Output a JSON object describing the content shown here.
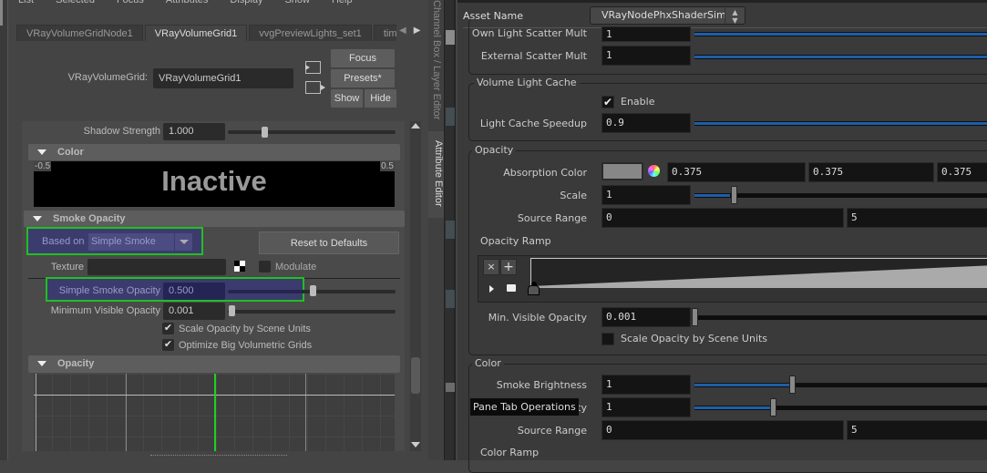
{
  "maya": {
    "menu": [
      "List",
      "Selected",
      "Focus",
      "Attributes",
      "Display",
      "Show",
      "Help"
    ],
    "tabs": [
      {
        "label": "VRayVolumeGridNode1",
        "active": false
      },
      {
        "label": "VRayVolumeGrid1",
        "active": true
      },
      {
        "label": "vvgPreviewLights_set1",
        "active": false
      },
      {
        "label": "tim",
        "active": false
      }
    ],
    "node_label": "VRayVolumeGrid:",
    "node_value": "VRayVolumeGrid1",
    "buttons": {
      "focus": "Focus",
      "presets": "Presets*",
      "show": "Show",
      "hide": "Hide",
      "reset": "Reset to Defaults"
    },
    "shadow_strength": {
      "label": "Shadow Strength",
      "value": "1.000",
      "slider": 0.22
    },
    "color_section": {
      "title": "Color",
      "min_label": "-0.5",
      "max_label": "0.5",
      "status": "Inactive"
    },
    "smoke_opacity_section": {
      "title": "Smoke Opacity",
      "based_on_label": "Based on",
      "based_on_value": "Simple Smoke",
      "texture_label": "Texture",
      "texture_value": "",
      "modulate_label": "Modulate",
      "modulate_checked": false,
      "simple_smoke_opacity": {
        "label": "Simple Smoke Opacity",
        "value": "0.500",
        "slider": 0.5
      },
      "min_visible_opacity": {
        "label": "Minimum Visible Opacity",
        "value": "0.001",
        "slider": 0.001
      },
      "scale_opacity": {
        "label": "Scale Opacity by Scene Units",
        "checked": true
      },
      "optimize": {
        "label": "Optimize Big Volumetric Grids",
        "checked": true
      }
    },
    "opacity_section": {
      "title": "Opacity"
    },
    "highlight_color": "#20c020"
  },
  "dock": {
    "channel_box": "Channel Box / Layer Editor",
    "attribute_editor": "Attribute Editor"
  },
  "houdini": {
    "asset_name_label": "Asset Name",
    "asset_name_value": "VRayNodePhxShaderSim",
    "rows_top": [
      {
        "label": "Own Light Scatter Mult",
        "value": "1"
      },
      {
        "label": "External Scatter Mult",
        "value": "1"
      }
    ],
    "volume_light_cache": {
      "title": "Volume Light Cache",
      "enable_label": "Enable",
      "enable_checked": true,
      "speedup_label": "Light Cache Speedup",
      "speedup_value": "0.9"
    },
    "opacity": {
      "title": "Opacity",
      "absorption_label": "Absorption Color",
      "absorption_values": [
        "0.375",
        "0.375",
        "0.375"
      ],
      "scale_label": "Scale",
      "scale_value": "1",
      "source_range_label": "Source Range",
      "source_range_values": [
        "0",
        "5"
      ],
      "ramp_label": "Opacity Ramp",
      "min_visible_label": "Min. Visible Opacity",
      "min_visible_value": "0.001",
      "scale_scene_label": "Scale Opacity by Scene Units",
      "scale_scene_checked": false
    },
    "color": {
      "title": "Color",
      "smoke_brightness_label": "Smoke Brightness",
      "smoke_brightness_value": "1",
      "row2_label_suffix": "icity",
      "row2_value": "1",
      "source_range_label": "Source Range",
      "source_range_values": [
        "0",
        "5"
      ],
      "ramp_label": "Color Ramp"
    },
    "tooltip": "Pane Tab Operations"
  }
}
